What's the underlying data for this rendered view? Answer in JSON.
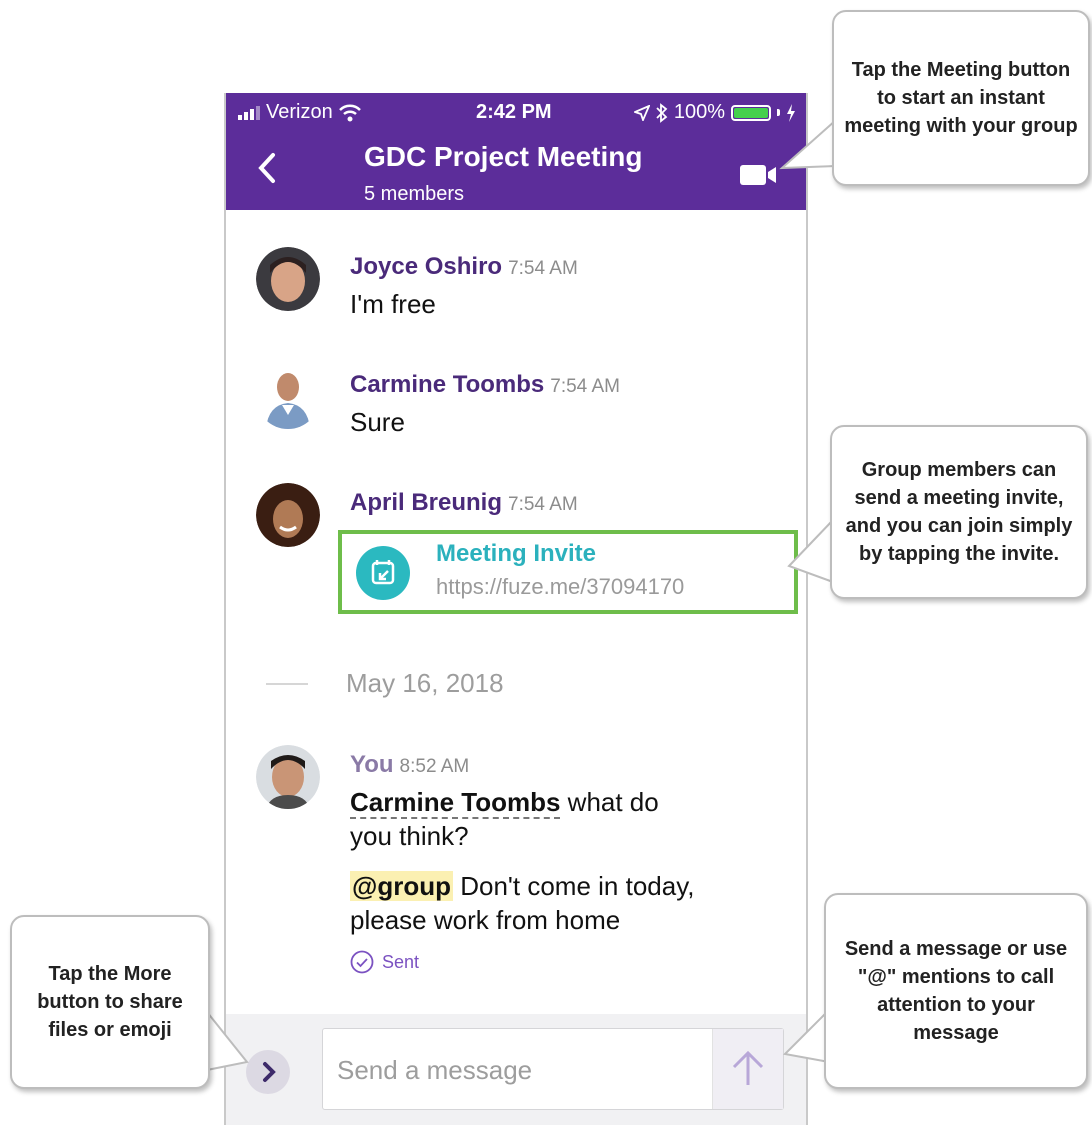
{
  "status_bar": {
    "carrier": "Verizon",
    "time": "2:42 PM",
    "battery": "100%",
    "battery_level": 1.0
  },
  "header": {
    "title": "GDC Project Meeting",
    "subtitle": "5 members",
    "back_icon": "chevron-left-icon",
    "video_icon": "video-camera-icon"
  },
  "messages": [
    {
      "sender": "Joyce Oshiro",
      "time": "7:54 AM",
      "text": "I'm free"
    },
    {
      "sender": "Carmine Toombs",
      "time": "7:54 AM",
      "text": "Sure"
    },
    {
      "sender": "April Breunig",
      "time": "7:54 AM",
      "invite": {
        "title": "Meeting Invite",
        "url": "https://fuze.me/37094170"
      }
    }
  ],
  "date_divider": "May 16, 2018",
  "own_message": {
    "sender": "You",
    "time": "8:52 AM",
    "mention": "Carmine Toombs",
    "line1_rest": " what do",
    "line2": "you think?",
    "group_tag": "@group",
    "line3_rest": " Don't come in today,",
    "line4": "please work from home",
    "status": "Sent"
  },
  "composer": {
    "placeholder": "Send a message",
    "more_icon": "chevron-right-icon",
    "send_icon": "arrow-up-icon"
  },
  "callouts": {
    "meeting": "Tap the Meeting button to start an instant meeting with your group",
    "invite": "Group members can send a meeting invite, and you can join simply by tapping the invite.",
    "more": "Tap the  More button to share files or emoji",
    "send": "Send a message or use \"@\" mentions to call attention to your message"
  },
  "colors": {
    "header": "#5c2d9a",
    "name": "#4a2a7a",
    "invite_border": "#6ebd4a",
    "invite_accent": "#2bb9c0",
    "sent": "#7b52c1"
  }
}
